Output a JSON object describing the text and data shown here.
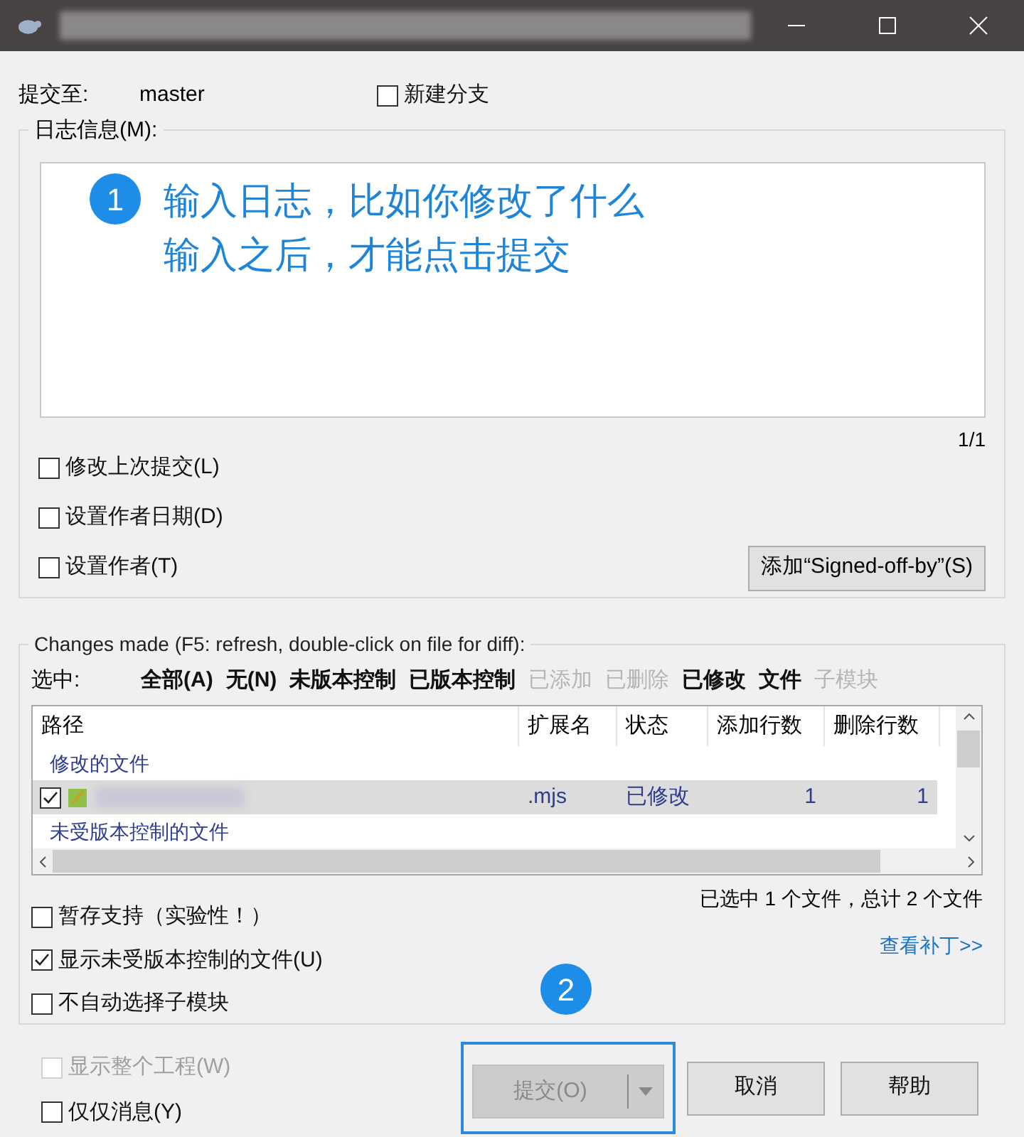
{
  "commit_to": {
    "label": "提交至:",
    "branch": "master",
    "new_branch": {
      "label": "新建分支",
      "checked": false
    }
  },
  "message_group": {
    "title": "日志信息(M):",
    "counter": "1/1",
    "options": [
      {
        "label": "修改上次提交(L)",
        "checked": false
      },
      {
        "label": "设置作者日期(D)",
        "checked": false
      },
      {
        "label": "设置作者(T)",
        "checked": false
      }
    ],
    "signoff_button": "添加“Signed-off-by”(S)"
  },
  "annotations": [
    {
      "number": "1",
      "lines": [
        "输入日志，比如你修改了什么",
        "输入之后，才能点击提交"
      ]
    },
    {
      "number": "2"
    }
  ],
  "changes_group": {
    "title": "Changes made (F5: refresh, double-click on file for diff):",
    "select_label": "选中:",
    "filters": [
      {
        "label": "全部(A)",
        "disabled": false
      },
      {
        "label": "无(N)",
        "disabled": false
      },
      {
        "label": "未版本控制",
        "disabled": false
      },
      {
        "label": "已版本控制",
        "disabled": false
      },
      {
        "label": "已添加",
        "disabled": true
      },
      {
        "label": "已删除",
        "disabled": true
      },
      {
        "label": "已修改",
        "disabled": false
      },
      {
        "label": "文件",
        "disabled": false
      },
      {
        "label": "子模块",
        "disabled": true
      }
    ],
    "table": {
      "columns": [
        "路径",
        "扩展名",
        "状态",
        "添加行数",
        "删除行数"
      ],
      "rows": [
        {
          "kind": "group",
          "label": "修改的文件"
        },
        {
          "kind": "file",
          "checked": true,
          "selected": true,
          "extension": ".mjs",
          "status": "已修改",
          "added": "1",
          "deleted": "1"
        },
        {
          "kind": "group",
          "label": "未受版本控制的文件"
        }
      ]
    },
    "summary": "已选中 1 个文件，总计 2 个文件",
    "view_patch": "查看补丁>>",
    "options": [
      {
        "label": "暂存支持（实验性！）",
        "checked": false
      },
      {
        "label": "显示未受版本控制的文件(U)",
        "checked": true
      },
      {
        "label": "不自动选择子模块",
        "checked": false
      }
    ]
  },
  "bottom_options": [
    {
      "label": "显示整个工程(W)",
      "checked": false,
      "disabled": true
    },
    {
      "label": "仅仅消息(Y)",
      "checked": false,
      "disabled": false
    }
  ],
  "buttons": [
    {
      "kind": "split",
      "label": "提交(O)",
      "disabled": true,
      "highlighted": true
    },
    {
      "kind": "plain",
      "label": "取消",
      "disabled": false,
      "highlighted": false
    },
    {
      "kind": "plain",
      "label": "帮助",
      "disabled": false,
      "highlighted": false
    }
  ]
}
